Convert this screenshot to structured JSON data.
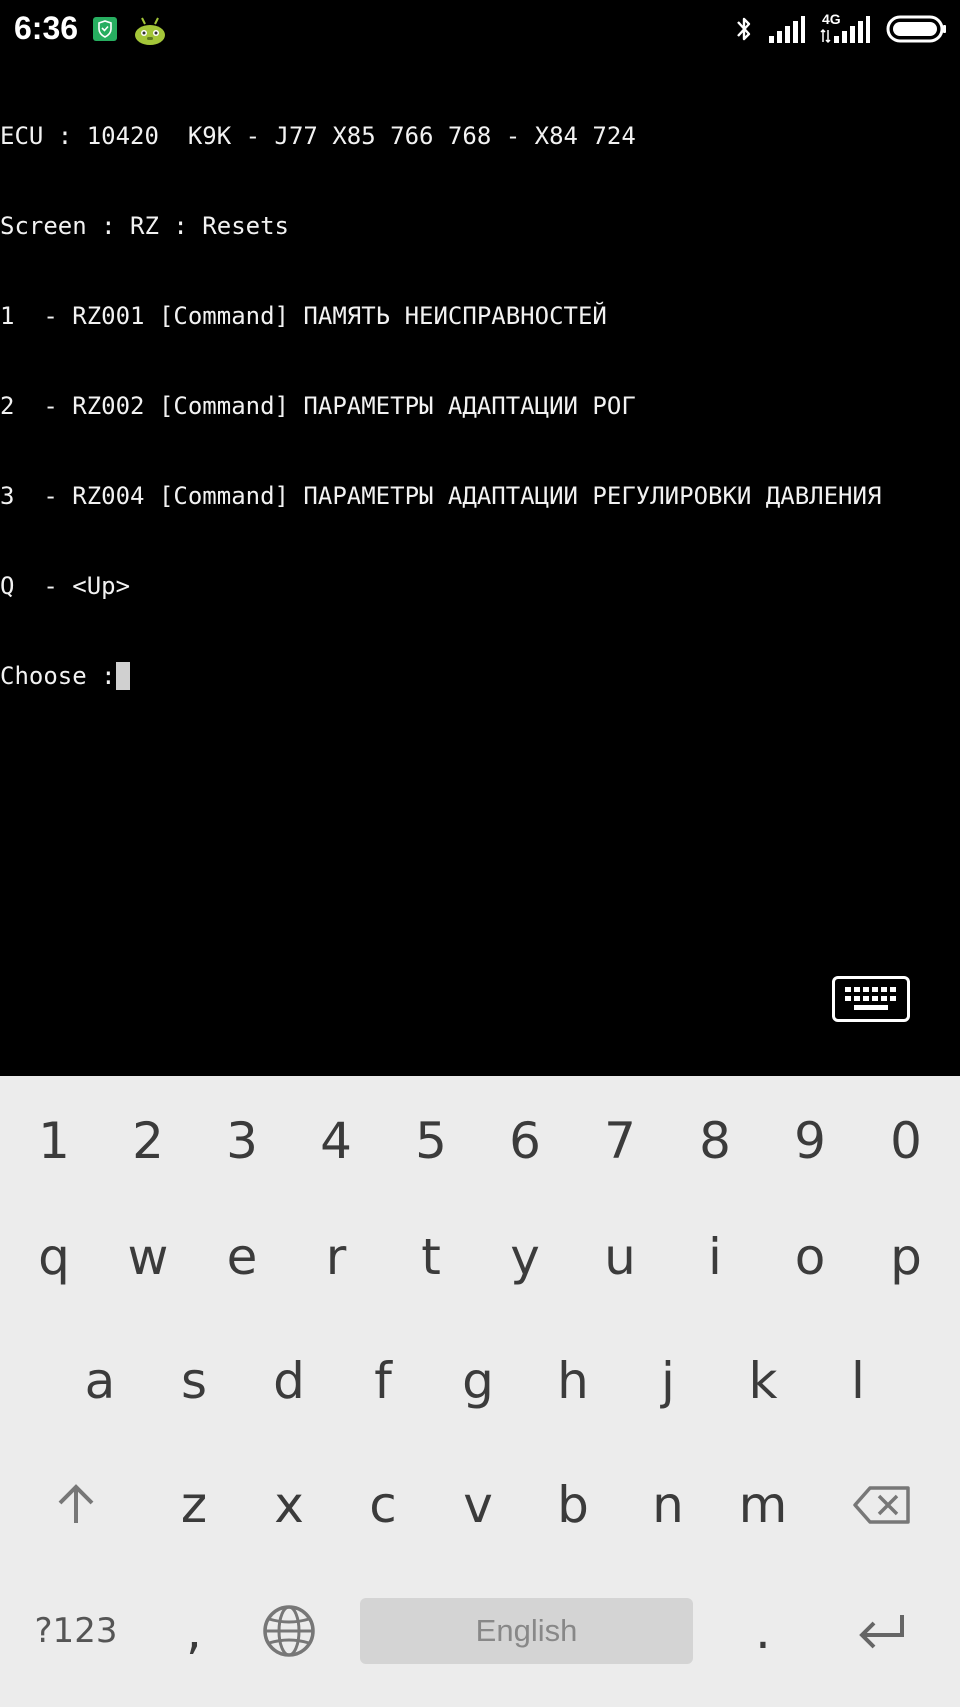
{
  "status_bar": {
    "time": "6:36",
    "network_type": "4G",
    "icons": [
      "shield-notification-icon",
      "android-notification-icon",
      "bluetooth-icon",
      "signal-icon",
      "signal-4g-icon",
      "battery-icon"
    ]
  },
  "terminal": {
    "lines": [
      "ECU : 10420  K9K - J77 X85 766 768 - X84 724",
      "Screen : RZ : Resets",
      "1  - RZ001 [Command] ПАМЯТЬ НЕИСПРАВНОСТЕЙ",
      "2  - RZ002 [Command] ПАРАМЕТРЫ АДАПТАЦИИ РОГ",
      "3  - RZ004 [Command] ПАРАМЕТРЫ АДАПТАЦИИ РЕГУЛИРОВКИ ДАВЛЕНИЯ",
      "Q  - <Up>"
    ],
    "prompt": "Choose :",
    "input_value": ""
  },
  "keyboard": {
    "number_row": [
      "1",
      "2",
      "3",
      "4",
      "5",
      "6",
      "7",
      "8",
      "9",
      "0"
    ],
    "row1": [
      "q",
      "w",
      "e",
      "r",
      "t",
      "y",
      "u",
      "i",
      "o",
      "p"
    ],
    "row2": [
      "a",
      "s",
      "d",
      "f",
      "g",
      "h",
      "j",
      "k",
      "l"
    ],
    "row3": [
      "z",
      "x",
      "c",
      "v",
      "b",
      "n",
      "m"
    ],
    "symbols_label": "?123",
    "comma_label": ",",
    "space_label": "English",
    "period_label": "."
  }
}
